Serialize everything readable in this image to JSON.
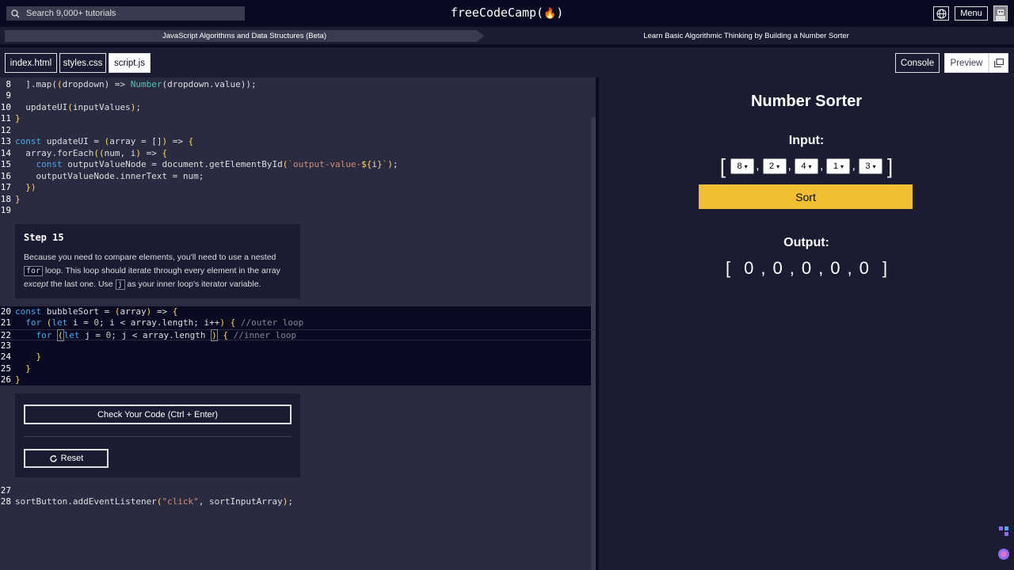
{
  "topnav": {
    "search_placeholder": "Search 9,000+ tutorials",
    "logo_text": "freeCodeCamp(",
    "logo_flame": "🔥",
    "logo_close": ")",
    "menu_label": "Menu"
  },
  "breadcrumb": {
    "course": "JavaScript Algorithms and Data Structures (Beta)",
    "project": "Learn Basic Algorithmic Thinking by Building a Number Sorter"
  },
  "tabs": {
    "index": "index.html",
    "styles": "styles.css",
    "script": "script.js",
    "console": "Console",
    "preview": "Preview"
  },
  "step": {
    "title": "Step 15",
    "text_1": "Because you need to compare elements, you'll need to use a nested ",
    "code_1": "for",
    "text_2": " loop. This loop should iterate through every element in the array ",
    "text_em": "except",
    "text_3": " the last one. Use ",
    "code_2": "j",
    "text_4": " as your inner loop's iterator variable."
  },
  "actions": {
    "check_label": "Check Your Code (Ctrl + Enter)",
    "reset_label": "Reset"
  },
  "preview": {
    "title": "Number Sorter",
    "input_label": "Input:",
    "inputs": [
      "8",
      "2",
      "4",
      "1",
      "3"
    ],
    "sort_label": "Sort",
    "output_label": "Output:",
    "outputs": [
      "0",
      "0",
      "0",
      "0",
      "0"
    ],
    "open_bracket": "[",
    "close_bracket": "]",
    "comma": ","
  },
  "code_line_numbers": [
    "8",
    "9",
    "10",
    "11",
    "12",
    "13",
    "14",
    "15",
    "16",
    "17",
    "18",
    "19",
    "20",
    "21",
    "22",
    "23",
    "24",
    "25",
    "26",
    "27",
    "28"
  ]
}
